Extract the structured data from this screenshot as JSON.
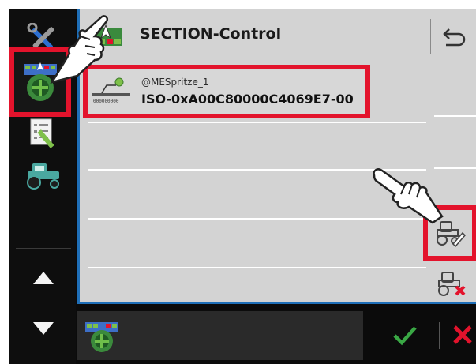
{
  "header": {
    "title": "SECTION-Control"
  },
  "list": {
    "items": [
      {
        "name": "@MESpritze_1",
        "id": "ISO-0xA00C80000C4069E7-00"
      }
    ]
  },
  "colors": {
    "highlight": "#e3132c",
    "accent_blue": "#1f6fb8",
    "panel_gray": "#d3d3d3",
    "ok_green": "#3aa845",
    "cancel_red": "#e3132c"
  },
  "icons": {
    "sidebar": [
      "tools-icon",
      "section-control-icon",
      "task-list-icon",
      "tractor-icon",
      "arrow-up-icon",
      "arrow-down-icon"
    ],
    "softkeys": [
      "edit-tractor-icon",
      "delete-tractor-icon"
    ],
    "header": [
      "section-control-icon",
      "back-icon"
    ],
    "bottom": [
      "section-control-icon",
      "checkmark-icon",
      "cancel-icon"
    ]
  }
}
